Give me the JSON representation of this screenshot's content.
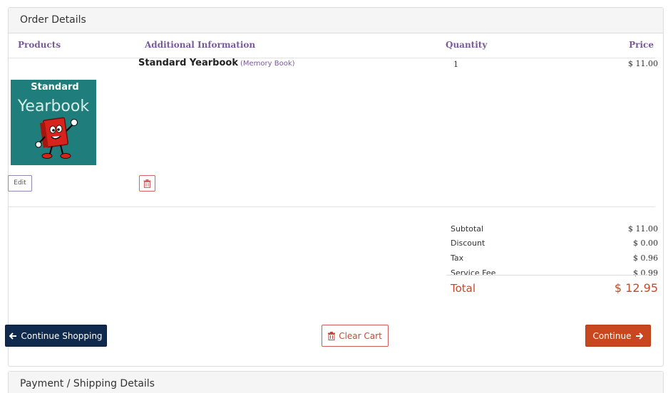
{
  "order_panel": {
    "title": "Order Details"
  },
  "columns": {
    "products": "Products",
    "additional_info": "Additional Information",
    "quantity": "Quantity",
    "price": "Price"
  },
  "line_item": {
    "name": "Standard Yearbook",
    "type": "(Memory Book)",
    "quantity": "1",
    "price": "$ 11.00",
    "thumbnail": {
      "title": "Standard",
      "subtitle": "Yearbook"
    },
    "edit_label": "Edit"
  },
  "summary": {
    "subtotal_label": "Subtotal",
    "subtotal": "$ 11.00",
    "discount_label": "Discount",
    "discount": "$ 0.00",
    "tax_label": "Tax",
    "tax": "$ 0.96",
    "service_fee_label": "Service Fee",
    "service_fee": "$ 0.99",
    "total_label": "Total",
    "total": "$ 12.95"
  },
  "actions": {
    "continue_shopping": "Continue Shopping",
    "clear_cart": "Clear Cart",
    "continue": "Continue"
  },
  "payment_panel": {
    "title": "Payment / Shipping Details"
  },
  "icons": {
    "continue_shopping": "arrow-left-icon",
    "clear_cart": "trash-icon",
    "continue": "arrow-right-icon",
    "remove_item": "trash-icon"
  },
  "colors": {
    "accent_purple": "#7a5a9a",
    "total_red": "#c2492a",
    "navy_button": "#102a4e",
    "orange_button": "#c9471f",
    "thumbnail_bg": "#1f7d7b"
  }
}
